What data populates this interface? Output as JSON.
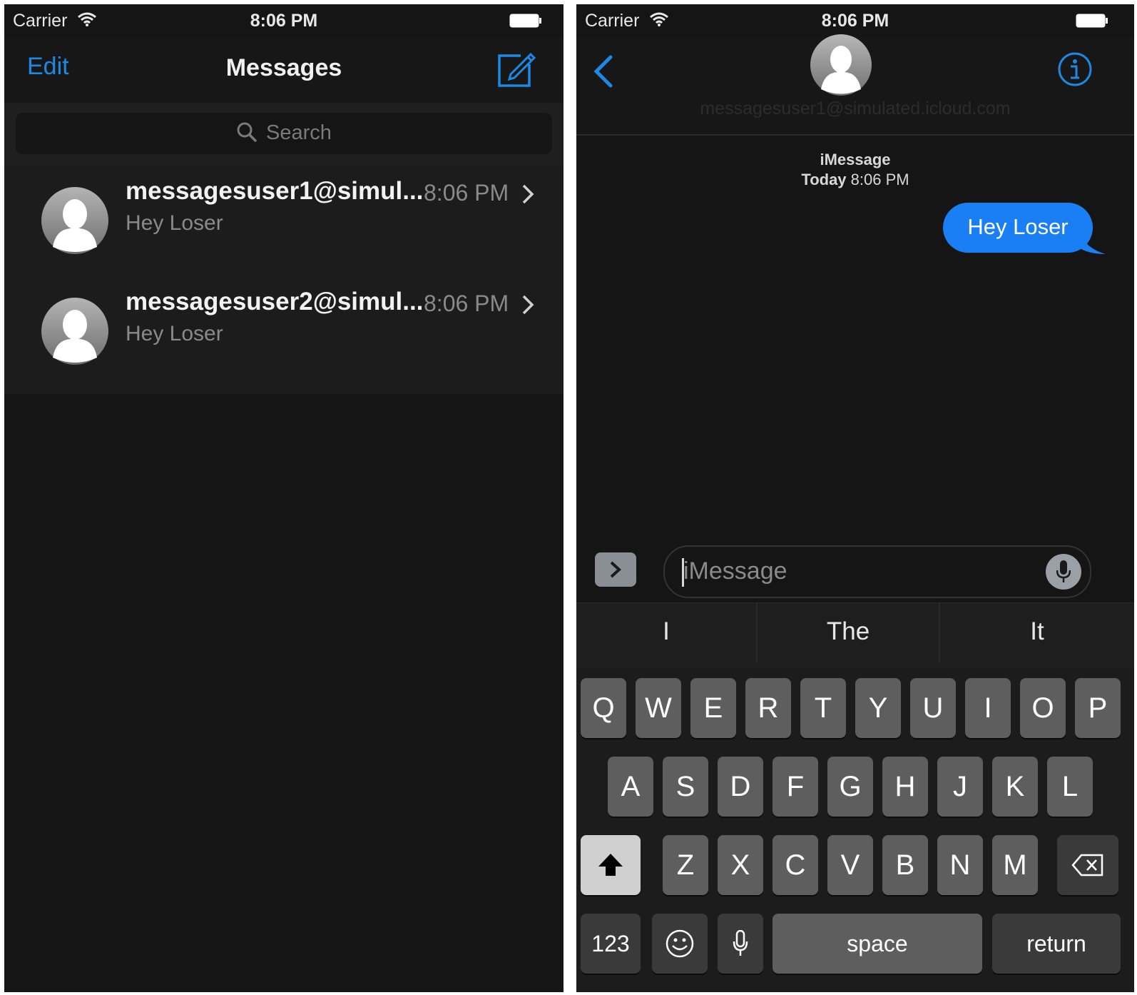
{
  "left_screen": {
    "status_bar": {
      "carrier": "Carrier",
      "time": "8:06 PM"
    },
    "nav": {
      "edit_label": "Edit",
      "title": "Messages",
      "compose_icon": "compose-icon"
    },
    "search": {
      "placeholder": "Search"
    },
    "conversations": [
      {
        "name": "messagesuser1@simul...",
        "time": "8:06 PM",
        "preview": "Hey Loser"
      },
      {
        "name": "messagesuser2@simul...",
        "time": "8:06 PM",
        "preview": "Hey Loser"
      }
    ]
  },
  "right_screen": {
    "status_bar": {
      "carrier": "Carrier",
      "time": "8:06 PM"
    },
    "nav": {
      "contact": "messagesuser1@simulated.icloud.com"
    },
    "thread": {
      "service": "iMessage",
      "day": "Today",
      "time": "8:06 PM",
      "messages": [
        {
          "text": "Hey Loser",
          "sent": true
        }
      ]
    },
    "input": {
      "placeholder": "iMessage"
    },
    "predictions": [
      "I",
      "The",
      "It"
    ],
    "keyboard": {
      "row1": [
        "Q",
        "W",
        "E",
        "R",
        "T",
        "Y",
        "U",
        "I",
        "O",
        "P"
      ],
      "row2": [
        "A",
        "S",
        "D",
        "F",
        "G",
        "H",
        "J",
        "K",
        "L"
      ],
      "row3": [
        "Z",
        "X",
        "C",
        "V",
        "B",
        "N",
        "M"
      ],
      "numbers_label": "123",
      "space_label": "space",
      "return_label": "return"
    }
  },
  "colors": {
    "accent": "#1e88e5",
    "bubble": "#1a7ff5",
    "background": "#151515",
    "key": "#5e5e5e",
    "key_dark": "#3a3a3a"
  }
}
